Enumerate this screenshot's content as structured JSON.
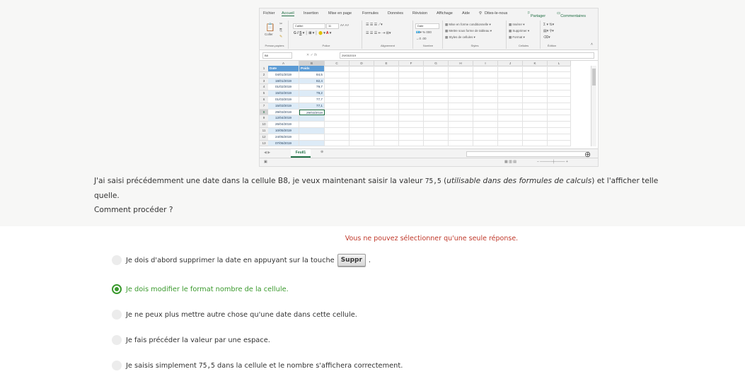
{
  "excel": {
    "menu": [
      "Fichier",
      "Accueil",
      "Insertion",
      "Mise en page",
      "Formules",
      "Données",
      "Révision",
      "Affichage",
      "Aide",
      "Dites-le-nous"
    ],
    "share": "Partager",
    "comments": "Commentaires",
    "ribbon": {
      "paste": "Coller",
      "font_name": "Calibri",
      "font_size": "11",
      "number_format": "Date",
      "cond_format": "Mise en forme conditionnelle",
      "table_format": "Mettre sous forme de tableau",
      "cell_styles": "Styles de cellules",
      "insert": "Insérer",
      "delete": "Supprimer",
      "format": "Format",
      "groups": [
        "Presse-papiers",
        "Police",
        "Alignement",
        "Nombre",
        "Styles",
        "Cellules",
        "Édition"
      ]
    },
    "name_box": "B8",
    "formula": "29/03/2019",
    "columns": [
      "A",
      "B",
      "C",
      "D",
      "E",
      "F",
      "G",
      "H",
      "I",
      "J",
      "K",
      "L"
    ],
    "rows": [
      {
        "n": "1",
        "a": "Date",
        "b": "Poids"
      },
      {
        "n": "2",
        "a": "04/01/2019",
        "b": "84,5"
      },
      {
        "n": "3",
        "a": "18/01/2019",
        "b": "82,4"
      },
      {
        "n": "4",
        "a": "01/02/2019",
        "b": "79,7"
      },
      {
        "n": "5",
        "a": "15/02/2019",
        "b": "79,2"
      },
      {
        "n": "6",
        "a": "01/03/2019",
        "b": "77,7"
      },
      {
        "n": "7",
        "a": "15/03/2019",
        "b": "77,1"
      },
      {
        "n": "8",
        "a": "29/03/2019",
        "b": "29/03/2019"
      },
      {
        "n": "9",
        "a": "12/04/2019",
        "b": ""
      },
      {
        "n": "10",
        "a": "26/04/2019",
        "b": ""
      },
      {
        "n": "11",
        "a": "10/05/2019",
        "b": ""
      },
      {
        "n": "12",
        "a": "24/05/2019",
        "b": ""
      },
      {
        "n": "13",
        "a": "07/06/2019",
        "b": ""
      }
    ],
    "sheet_tab": "Feuil1"
  },
  "question": {
    "part1": "J'ai saisi précédemment une date dans la cellule B8, je veux maintenant saisir la valeur",
    "value": "75,5",
    "part2": "(",
    "italic": "utilisable dans des formules de calculs",
    "part3": ") et l'afficher telle quelle.",
    "line2": "Comment procéder ?"
  },
  "warning": "Vous ne pouvez sélectionner qu'une seule réponse.",
  "options": {
    "o1_pre": "Je dois d'abord supprimer la date en appuyant sur la touche",
    "o1_key": "Suppr",
    "o1_post": ".",
    "o2": "Je dois modifier le format nombre de la cellule.",
    "o3": "Je ne peux plus mettre autre chose qu'une date dans cette cellule.",
    "o4": "Je fais précéder la valeur par une espace.",
    "o5_pre": "Je saisis simplement",
    "o5_value": "75,5",
    "o5_post": "dans la cellule et le nombre s'affichera correctement."
  },
  "colors": {
    "correct": "#3b9a2e",
    "warning": "#c0392b",
    "header_fill": "#5b9bd5",
    "zebra": "#ddebf7"
  }
}
